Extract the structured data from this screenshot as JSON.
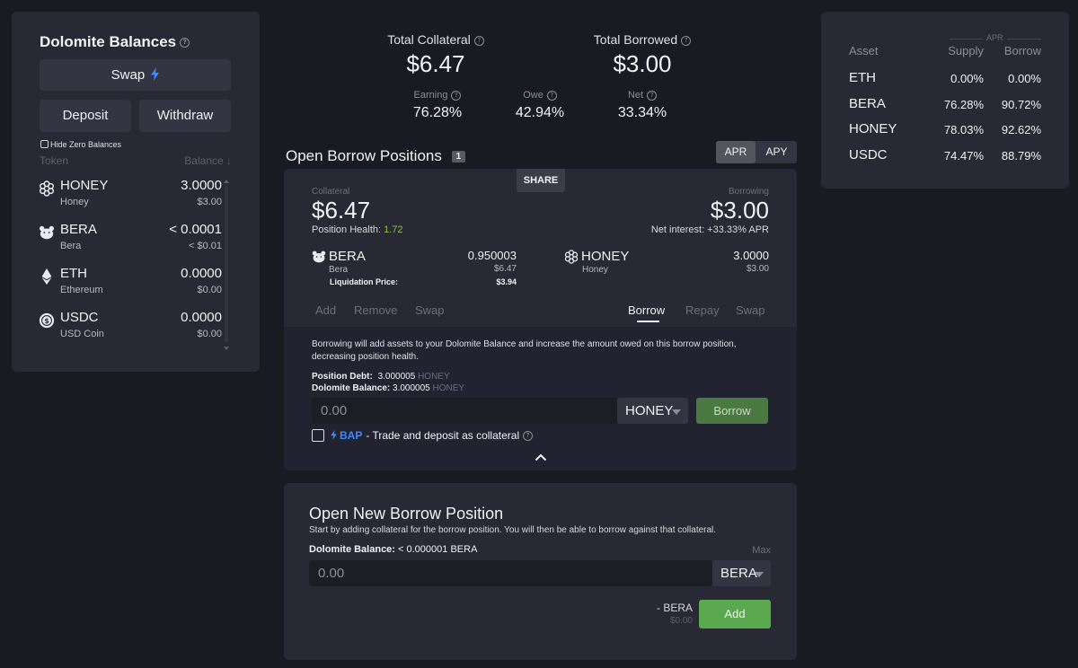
{
  "balances": {
    "title": "Dolomite Balances",
    "swap_label": "Swap",
    "deposit_label": "Deposit",
    "withdraw_label": "Withdraw",
    "hide_zero_label": "Hide Zero Balances",
    "col_token": "Token",
    "col_balance": "Balance ↓",
    "tokens": [
      {
        "symbol": "HONEY",
        "name": "Honey",
        "balance": "3.0000",
        "usd": "$3.00",
        "icon": "honey-icon"
      },
      {
        "symbol": "BERA",
        "name": "Bera",
        "balance": "< 0.0001",
        "usd": "< $0.01",
        "icon": "bera-icon"
      },
      {
        "symbol": "ETH",
        "name": "Ethereum",
        "balance": "0.0000",
        "usd": "$0.00",
        "icon": "eth-icon"
      },
      {
        "symbol": "USDC",
        "name": "USD Coin",
        "balance": "0.0000",
        "usd": "$0.00",
        "icon": "usdc-icon"
      }
    ]
  },
  "summary": {
    "collateral_label": "Total Collateral",
    "collateral_value": "$6.47",
    "borrowed_label": "Total Borrowed",
    "borrowed_value": "$3.00",
    "earning_label": "Earning",
    "earning_value": "76.28%",
    "owe_label": "Owe",
    "owe_value": "42.94%",
    "net_label": "Net",
    "net_value": "33.34%"
  },
  "apr_table": {
    "group_label": "APR",
    "col_asset": "Asset",
    "col_supply": "Supply",
    "col_borrow": "Borrow",
    "rows": [
      {
        "asset": "ETH",
        "supply": "0.00%",
        "borrow": "0.00%"
      },
      {
        "asset": "BERA",
        "supply": "76.28%",
        "borrow": "90.72%"
      },
      {
        "asset": "HONEY",
        "supply": "78.03%",
        "borrow": "92.62%"
      },
      {
        "asset": "USDC",
        "supply": "74.47%",
        "borrow": "88.79%"
      }
    ]
  },
  "positions": {
    "title": "Open Borrow Positions",
    "count": "1",
    "toggle_apr": "APR",
    "toggle_apy": "APY",
    "share_label": "SHARE",
    "card": {
      "collateral_label": "Collateral",
      "collateral_value": "$6.47",
      "health_label": "Position Health:",
      "health_value": "1.72",
      "borrowing_label": "Borrowing",
      "borrowing_value": "$3.00",
      "net_interest": "Net interest: +33.33% APR",
      "coll_symbol": "BERA",
      "coll_name": "Bera",
      "coll_amount": "0.950003",
      "coll_usd": "$6.47",
      "liq_label": "Liquidation Price:",
      "liq_value": "$3.94",
      "borrow_symbol": "HONEY",
      "borrow_name": "Honey",
      "borrow_amount": "3.0000",
      "borrow_usd": "$3.00",
      "tabs_left": [
        "Add",
        "Remove",
        "Swap"
      ],
      "tabs_right": [
        "Borrow",
        "Repay",
        "Swap"
      ],
      "description": "Borrowing will add assets to your Dolomite Balance and increase the amount owed on this borrow position, decreasing position health.",
      "debt_label": "Position Debt:",
      "debt_value": "3.000005",
      "debt_unit": "HONEY",
      "dolo_label": "Dolomite Balance:",
      "dolo_value": "3.000005",
      "dolo_unit": "HONEY",
      "amount_placeholder": "0.00",
      "token_select": "HONEY",
      "borrow_button": "Borrow",
      "bap_label": "BAP",
      "bap_text": "- Trade and deposit as collateral"
    }
  },
  "new_position": {
    "title": "Open New Borrow Position",
    "subtitle": "Start by adding collateral for the borrow position. You will then be able to borrow against that collateral.",
    "balance_label": "Dolomite Balance:",
    "balance_value": "< 0.000001 BERA",
    "max_label": "Max",
    "amount_placeholder": "0.00",
    "token_select": "BERA",
    "preview_amount": "- BERA",
    "preview_usd": "$0.00",
    "add_button": "Add"
  },
  "colors": {
    "accent_green": "#5aa94e",
    "health_green": "#8bc34a",
    "bap_blue": "#3d8bfd",
    "panel": "#292935",
    "background": "#1a1a22"
  }
}
